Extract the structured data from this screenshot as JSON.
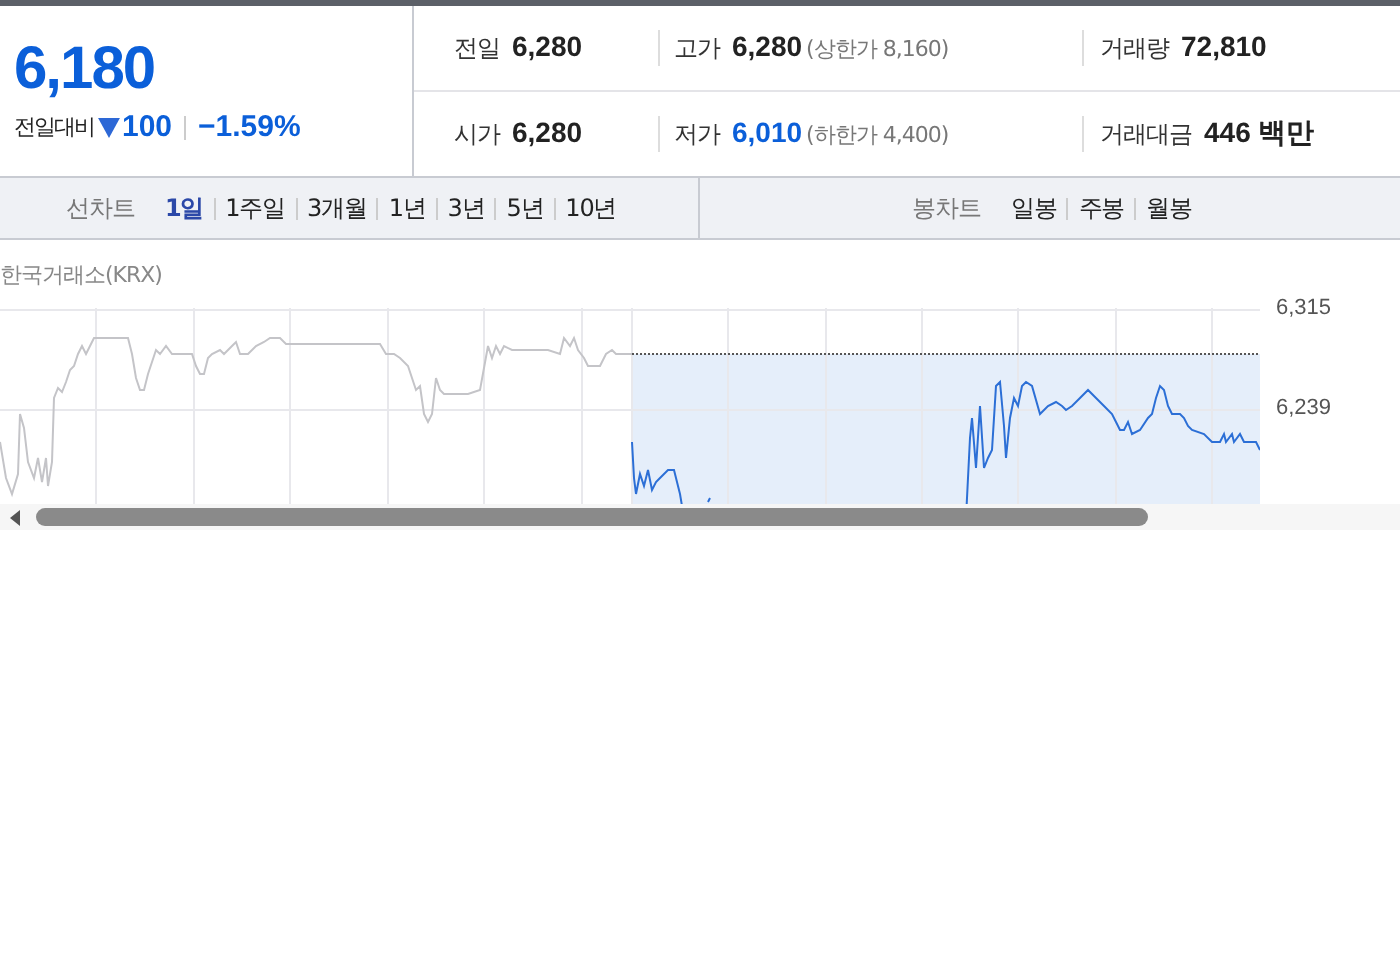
{
  "price": {
    "current": "6,180",
    "change_label": "전일대비",
    "falling": true,
    "change": "100",
    "change_rate": "−1.59%"
  },
  "stats": [
    [
      {
        "label": "전일",
        "value": "6,280"
      },
      {
        "label": "고가",
        "value": "6,280",
        "note": "(상한가 8,160)"
      },
      {
        "label": "거래량",
        "value": "72,810"
      }
    ],
    [
      {
        "label": "시가",
        "value": "6,280"
      },
      {
        "label": "저가",
        "value": "6,010",
        "note": "(하한가 4,400)",
        "falling": true
      },
      {
        "label": "거래대금",
        "value": "446 백만"
      }
    ]
  ],
  "line_chart": {
    "label": "선차트",
    "tabs": [
      {
        "label": "1일",
        "selected": true
      },
      {
        "label": "1주일",
        "selected": false
      },
      {
        "label": "3개월",
        "selected": false
      },
      {
        "label": "1년",
        "selected": false
      },
      {
        "label": "3년",
        "selected": false
      },
      {
        "label": "5년",
        "selected": false
      },
      {
        "label": "10년",
        "selected": false
      }
    ]
  },
  "candle_chart": {
    "label": "봉차트",
    "tabs": [
      {
        "label": "일봉",
        "selected": false
      },
      {
        "label": "주봉",
        "selected": false
      },
      {
        "label": "월봉",
        "selected": false
      }
    ]
  },
  "chart": {
    "exchange": "한국거래소(KRX)",
    "y_ticks": [
      "6,315",
      "6,239"
    ]
  }
}
